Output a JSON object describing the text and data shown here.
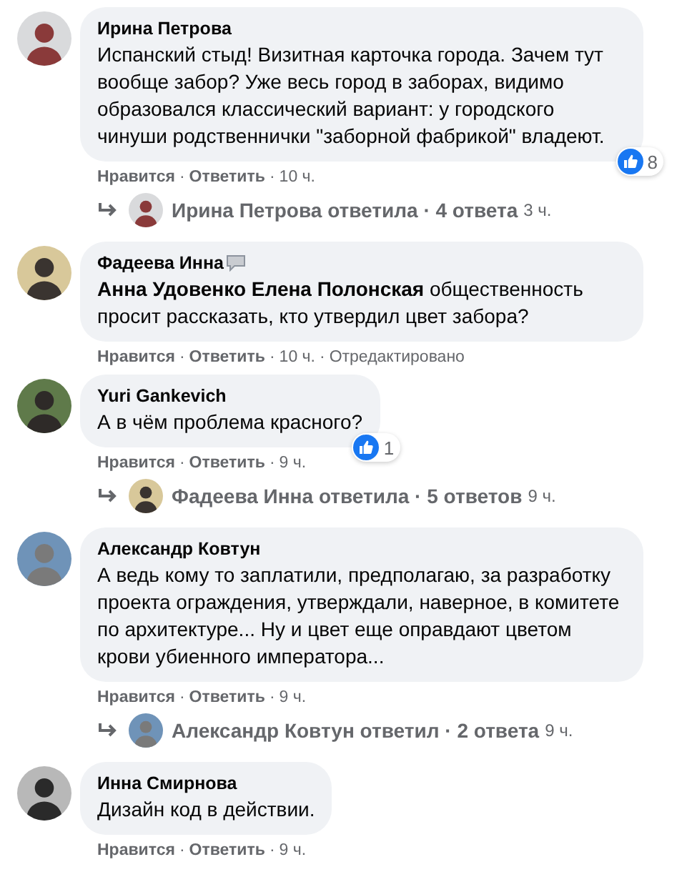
{
  "separator": "·",
  "comments": [
    {
      "author": "Ирина Петрова",
      "badge": false,
      "text": "Испанский стыд! Визитная карточка города. Зачем тут вообще забор? Уже весь город в заборах, видимо образовался классический вариант: у городского чинуши родственнички \"заборной фабрикой\" владеют.",
      "reactions": "8",
      "like": "Нравится",
      "reply": "Ответить",
      "time": "10 ч.",
      "replies": {
        "text": "Ирина Петрова ответила · 4 ответа",
        "time": "3 ч."
      }
    },
    {
      "author": "Фадеева Инна",
      "badge": true,
      "text": "**Анна Удовенко Елена Полонская** общественность просит рассказать, кто утвердил цвет забора?",
      "like": "Нравится",
      "reply": "Ответить",
      "time": "10 ч.",
      "edited": "Отредактировано"
    },
    {
      "author": "Yuri Gankevich",
      "badge": false,
      "text": "А в чём проблема красного?",
      "reactions": "1",
      "like": "Нравится",
      "reply": "Ответить",
      "time": "9 ч.",
      "replies": {
        "text": "Фадеева Инна ответила · 5 ответов",
        "time": "9 ч."
      }
    },
    {
      "author": "Александр Ковтун",
      "badge": false,
      "text": "А ведь кому то заплатили, предполагаю, за разработку проекта ограждения, утверждали, наверное, в комитете по архитектуре... Ну и цвет еще оправдают цветом крови убиенного императора...",
      "like": "Нравится",
      "reply": "Ответить",
      "time": "9 ч.",
      "replies": {
        "text": "Александр Ковтун ответил · 2 ответа",
        "time": "9 ч."
      }
    },
    {
      "author": "Инна Смирнова",
      "badge": false,
      "text": "Дизайн код в действии.",
      "like": "Нравится",
      "reply": "Ответить",
      "time": "9 ч."
    }
  ]
}
